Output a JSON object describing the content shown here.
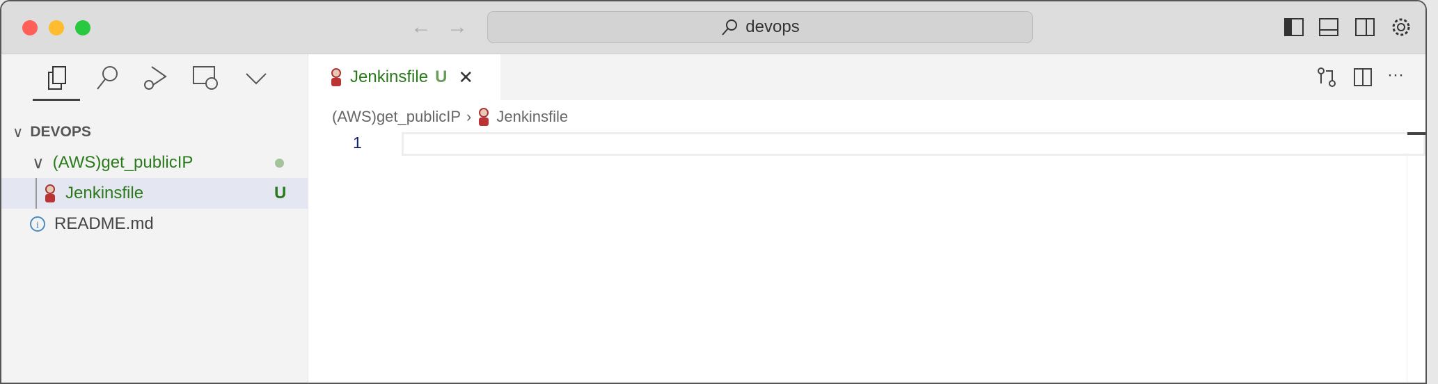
{
  "title_bar": {
    "search_text": "devops"
  },
  "activity": [
    "explorer-icon",
    "search-icon",
    "run-debug-icon",
    "remote-explorer-icon",
    "more-chevron-icon"
  ],
  "explorer": {
    "section": "DEVOPS",
    "folder": "(AWS)get_publicIP",
    "file": "Jenkinsfile",
    "file_badge": "U",
    "readme": "README.md"
  },
  "editor": {
    "tab_label": "Jenkinsfile",
    "tab_badge": "U",
    "breadcrumb": [
      "(AWS)get_publicIP",
      "Jenkinsfile"
    ],
    "line_number": "1"
  },
  "colors": {
    "git_untracked": "#2a7a1b",
    "selection": "#e4e6f1"
  }
}
